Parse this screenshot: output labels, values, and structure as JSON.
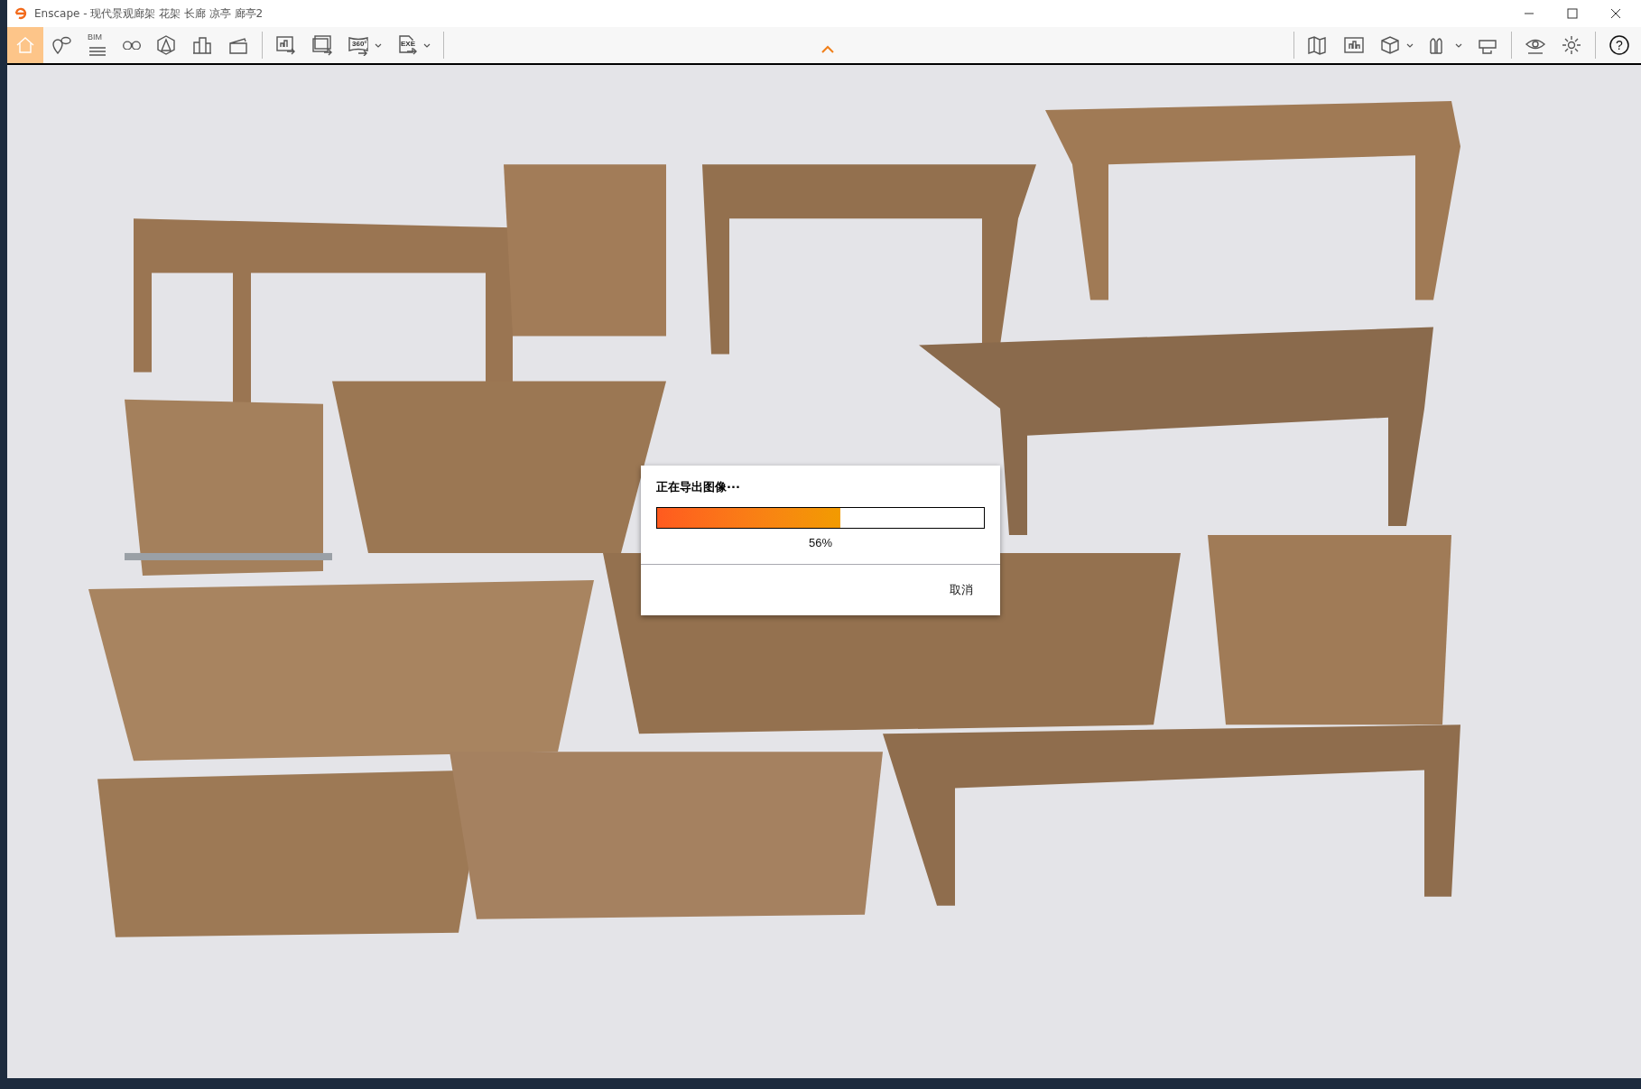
{
  "window": {
    "title": "Enscape - 现代景观廊架 花架 长廊 凉亭 廊亭2"
  },
  "toolbar": {
    "left": [
      {
        "kind": "home",
        "selected": true
      },
      {
        "kind": "pin",
        "selected": false
      },
      {
        "kind": "bim",
        "label": "BIM",
        "selected": false
      },
      {
        "kind": "binoculars",
        "selected": false
      },
      {
        "kind": "perspective",
        "selected": false
      },
      {
        "kind": "buildings",
        "selected": false
      },
      {
        "kind": "clapper",
        "selected": false
      },
      {
        "kind": "separator"
      },
      {
        "kind": "export-image",
        "selected": false
      },
      {
        "kind": "export-batch",
        "selected": false
      },
      {
        "kind": "export-panorama",
        "label": "360°",
        "dropdown": true,
        "selected": false
      },
      {
        "kind": "export-exe",
        "label": "EXE",
        "dropdown": true,
        "selected": false
      },
      {
        "kind": "separator"
      }
    ],
    "right": [
      {
        "kind": "separator"
      },
      {
        "kind": "map",
        "selected": false
      },
      {
        "kind": "gallery",
        "selected": false
      },
      {
        "kind": "cube",
        "dropdown": true,
        "selected": false
      },
      {
        "kind": "arches",
        "dropdown": true,
        "selected": false
      },
      {
        "kind": "vr",
        "selected": false
      },
      {
        "kind": "separator"
      },
      {
        "kind": "eye",
        "selected": false
      },
      {
        "kind": "gear",
        "selected": false
      },
      {
        "kind": "separator"
      },
      {
        "kind": "help",
        "label": "?",
        "selected": false
      }
    ]
  },
  "dialog": {
    "title": "正在导出图像···",
    "progress": {
      "level": 0.56,
      "reading": "56%"
    },
    "buttons": [
      "取消"
    ]
  }
}
